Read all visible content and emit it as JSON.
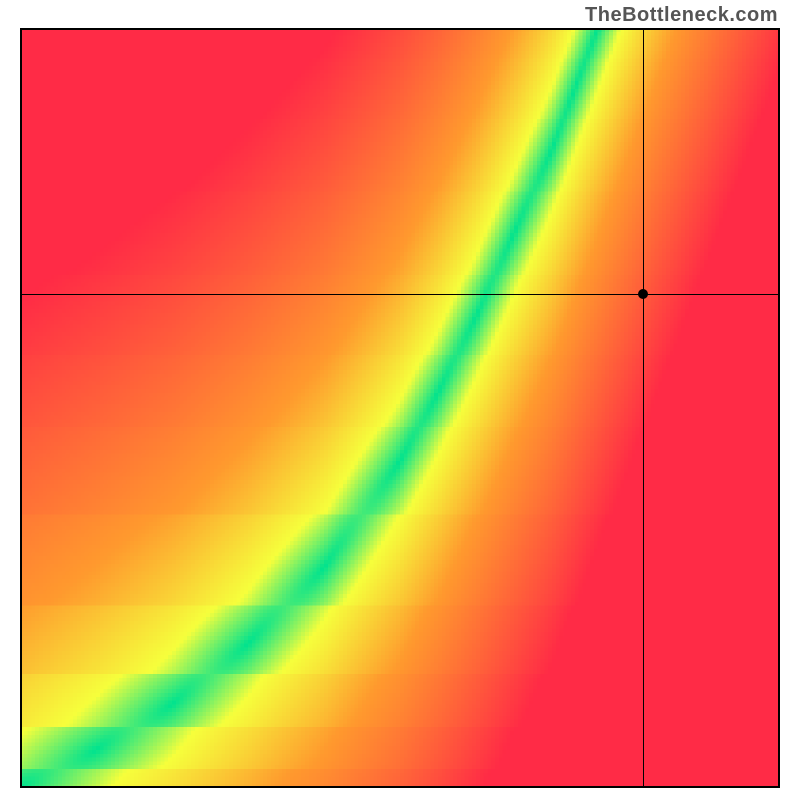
{
  "attribution": "TheBottleneck.com",
  "chart_data": {
    "type": "heatmap",
    "title": "",
    "xlabel": "",
    "ylabel": "",
    "xlim": [
      0,
      100
    ],
    "ylim": [
      0,
      100
    ],
    "legend": false,
    "tick_labels": [],
    "colorscale_note": "green at optimal match, grading through yellow and orange to red toward mismatch extremes",
    "optimal_curve_x": [
      0,
      10,
      20,
      30,
      40,
      50,
      55,
      60,
      65,
      70,
      73,
      76
    ],
    "optimal_curve_y": [
      0,
      5,
      11,
      19,
      29,
      43,
      52,
      62,
      73,
      84,
      92,
      100
    ],
    "crosshair": {
      "x": 82,
      "y": 65
    },
    "marker": {
      "x": 82,
      "y": 65
    }
  }
}
